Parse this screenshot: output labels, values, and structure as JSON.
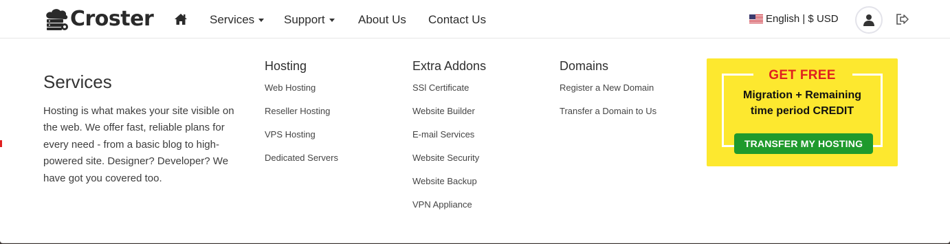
{
  "brand": {
    "name": "Croster"
  },
  "nav": {
    "home_icon": "home-icon",
    "items": [
      {
        "label": "Services",
        "has_dropdown": true
      },
      {
        "label": "Support",
        "has_dropdown": true
      },
      {
        "label": "About Us",
        "has_dropdown": false
      },
      {
        "label": "Contact Us",
        "has_dropdown": false
      }
    ],
    "language": "English | $ USD",
    "flag_icon": "us-flag-icon",
    "account_icon": "user-icon",
    "logout_icon": "logout-icon"
  },
  "mega_menu": {
    "intro": {
      "title": "Services",
      "text": "Hosting is what makes your site visible on the web. We offer fast, reliable plans for every need - from a basic blog to high-powered site. Designer? Developer? We have got you covered too."
    },
    "columns": [
      {
        "title": "Hosting",
        "links": [
          "Web Hosting",
          "Reseller Hosting",
          "VPS Hosting",
          "Dedicated Servers"
        ]
      },
      {
        "title": "Extra Addons",
        "links": [
          "SSl Certificate",
          "Website Builder",
          "E-mail Services",
          "Website Security",
          "Website Backup",
          "VPN Appliance"
        ]
      },
      {
        "title": "Domains",
        "links": [
          "Register a New Domain",
          "Transfer a Domain to Us"
        ]
      }
    ],
    "promo": {
      "headline": "GET FREE",
      "line1": "Migration + Remaining",
      "line2": "time period CREDIT",
      "button": "TRANSFER MY HOSTING",
      "colors": {
        "background": "#fde82f",
        "headline": "#e02020",
        "button": "#1f9a2c"
      }
    }
  }
}
